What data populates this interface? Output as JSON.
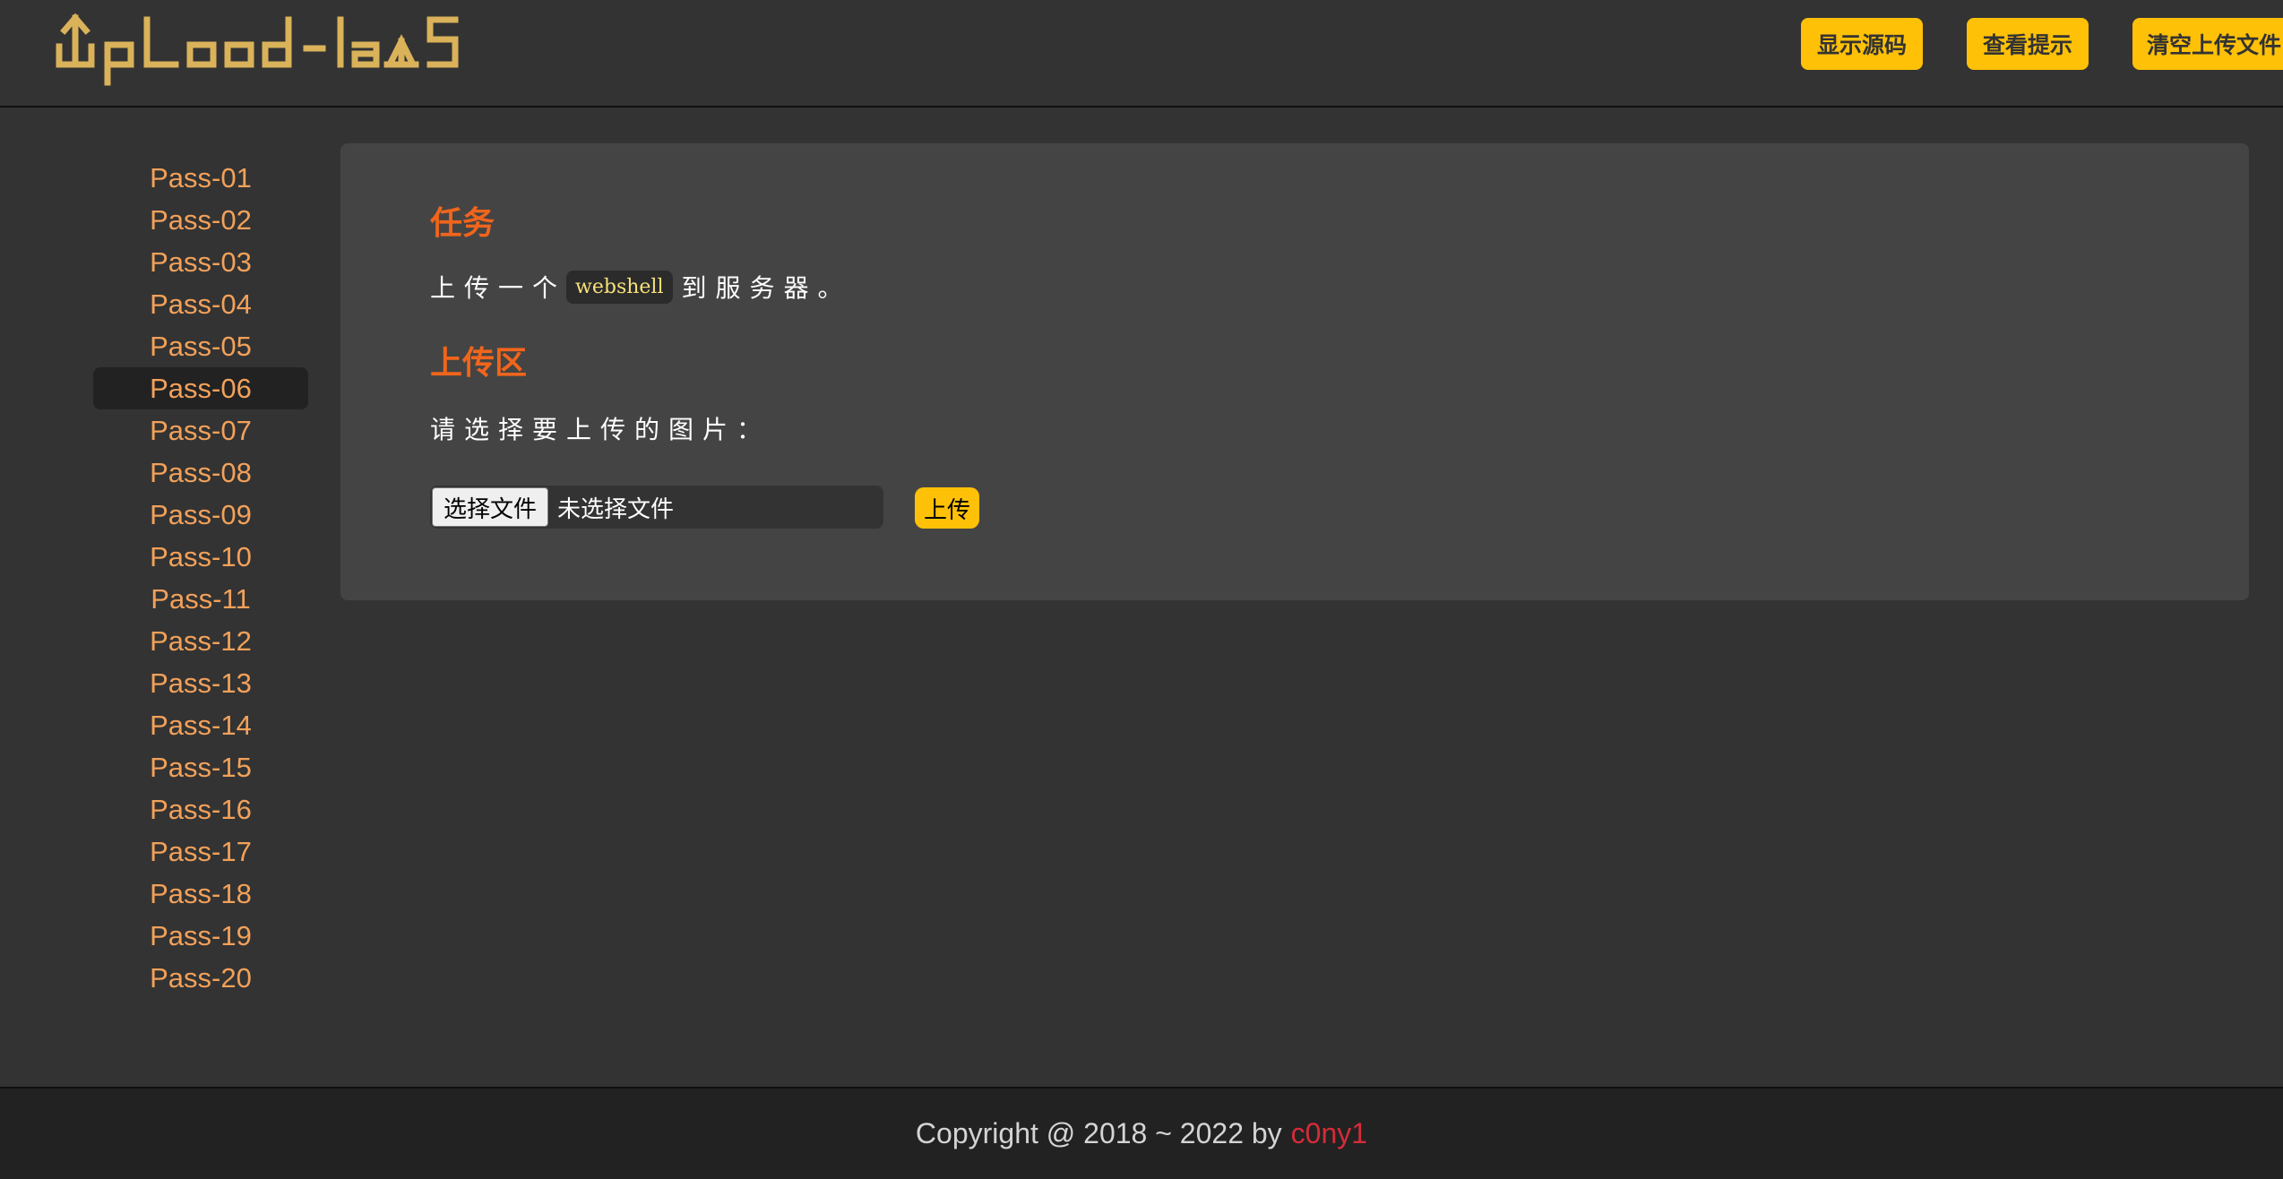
{
  "header": {
    "logo_text": "UpLoad-LaBS",
    "buttons": {
      "show_source": "显示源码",
      "view_hint": "查看提示",
      "clear_uploads": "清空上传文件"
    }
  },
  "sidebar": {
    "items": [
      {
        "label": "Pass-01"
      },
      {
        "label": "Pass-02"
      },
      {
        "label": "Pass-03"
      },
      {
        "label": "Pass-04"
      },
      {
        "label": "Pass-05"
      },
      {
        "label": "Pass-06"
      },
      {
        "label": "Pass-07"
      },
      {
        "label": "Pass-08"
      },
      {
        "label": "Pass-09"
      },
      {
        "label": "Pass-10"
      },
      {
        "label": "Pass-11"
      },
      {
        "label": "Pass-12"
      },
      {
        "label": "Pass-13"
      },
      {
        "label": "Pass-14"
      },
      {
        "label": "Pass-15"
      },
      {
        "label": "Pass-16"
      },
      {
        "label": "Pass-17"
      },
      {
        "label": "Pass-18"
      },
      {
        "label": "Pass-19"
      },
      {
        "label": "Pass-20"
      }
    ],
    "active_label": "Pass-06"
  },
  "main": {
    "task_title": "任务",
    "task_prefix": "上传一个",
    "task_code": "webshell",
    "task_suffix": "到服务器。",
    "upload_title": "上传区",
    "upload_prompt": "请选择要上传的图片：",
    "file_input": {
      "button_label": "选择文件",
      "status": "未选择文件"
    },
    "submit_label": "上传"
  },
  "footer": {
    "copyright": "Copyright @ 2018 ~ 2022 by",
    "author": "c0ny1"
  },
  "colors": {
    "accent": "#ffc107",
    "logo": "#d9b25a",
    "sidebar_link": "#f2a15a",
    "section_title": "#f0651c",
    "author": "#d42c3a"
  }
}
